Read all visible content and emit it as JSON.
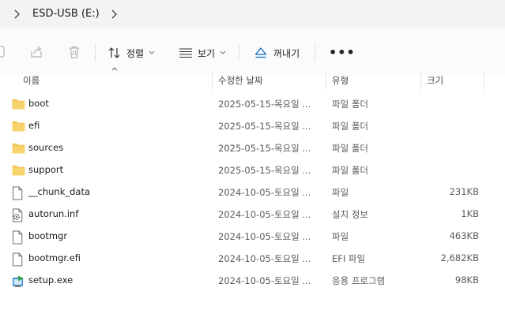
{
  "address": {
    "path": "ESD-USB (E:)"
  },
  "toolbar": {
    "sort_label": "정렬",
    "view_label": "보기",
    "eject_label": "꺼내기",
    "more_label": "•••"
  },
  "columns": {
    "name": "이름",
    "date": "수정한 날짜",
    "type": "유형",
    "size": "크기"
  },
  "files": [
    {
      "name": "boot",
      "date": "2025-05-15-목요일 ...",
      "type": "파일 폴더",
      "size": "",
      "icon": "folder-icon"
    },
    {
      "name": "efi",
      "date": "2025-05-15-목요일 ...",
      "type": "파일 폴더",
      "size": "",
      "icon": "folder-icon"
    },
    {
      "name": "sources",
      "date": "2025-05-15-목요일 ...",
      "type": "파일 폴더",
      "size": "",
      "icon": "folder-icon"
    },
    {
      "name": "support",
      "date": "2025-05-15-목요일 ...",
      "type": "파일 폴더",
      "size": "",
      "icon": "folder-icon"
    },
    {
      "name": "__chunk_data",
      "date": "2024-10-05-토요일 ...",
      "type": "파일",
      "size": "231KB",
      "icon": "file-icon"
    },
    {
      "name": "autorun.inf",
      "date": "2024-10-05-토요일 ...",
      "type": "설치 정보",
      "size": "1KB",
      "icon": "settings-file-icon"
    },
    {
      "name": "bootmgr",
      "date": "2024-10-05-토요일 ...",
      "type": "파일",
      "size": "463KB",
      "icon": "file-icon"
    },
    {
      "name": "bootmgr.efi",
      "date": "2024-10-05-토요일 ...",
      "type": "EFI 파일",
      "size": "2,682KB",
      "icon": "file-icon"
    },
    {
      "name": "setup.exe",
      "date": "2024-10-05-토요일 ...",
      "type": "응용 프로그램",
      "size": "98KB",
      "icon": "setup-exe-icon"
    }
  ],
  "colors": {
    "folder": "#f2c75c",
    "accent": "#0067c0"
  }
}
